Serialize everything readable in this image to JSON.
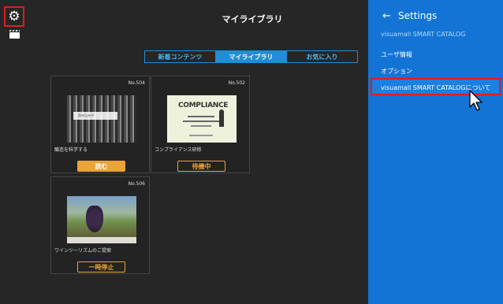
{
  "header": {
    "title": "マイライブラリ"
  },
  "tabs": [
    {
      "label": "新着コンテンツ"
    },
    {
      "label": "マイライブラリ"
    },
    {
      "label": "お気に入り"
    }
  ],
  "books": [
    {
      "no": "No.504",
      "caption": "醸造を科学する",
      "button": "読む",
      "cover_banner": "読み込み中"
    },
    {
      "no": "No.502",
      "caption": "コンプライアンス研修",
      "button": "待機中",
      "cover_title": "COMPLIANCE"
    },
    {
      "no": "No.506",
      "caption": "ワインツーリズムのご提案",
      "button": "一時停止"
    }
  ],
  "settings": {
    "title": "Settings",
    "app_name": "visuamall SMART CATALOG",
    "items": [
      {
        "label": "ユーザ情報"
      },
      {
        "label": "オプション"
      },
      {
        "label": "visuamall SMART CATALOGについて"
      }
    ]
  },
  "colors": {
    "accent": "#1e8fd6",
    "panel": "#1374d6",
    "button": "#e9a43a",
    "highlight": "#e21b23"
  }
}
